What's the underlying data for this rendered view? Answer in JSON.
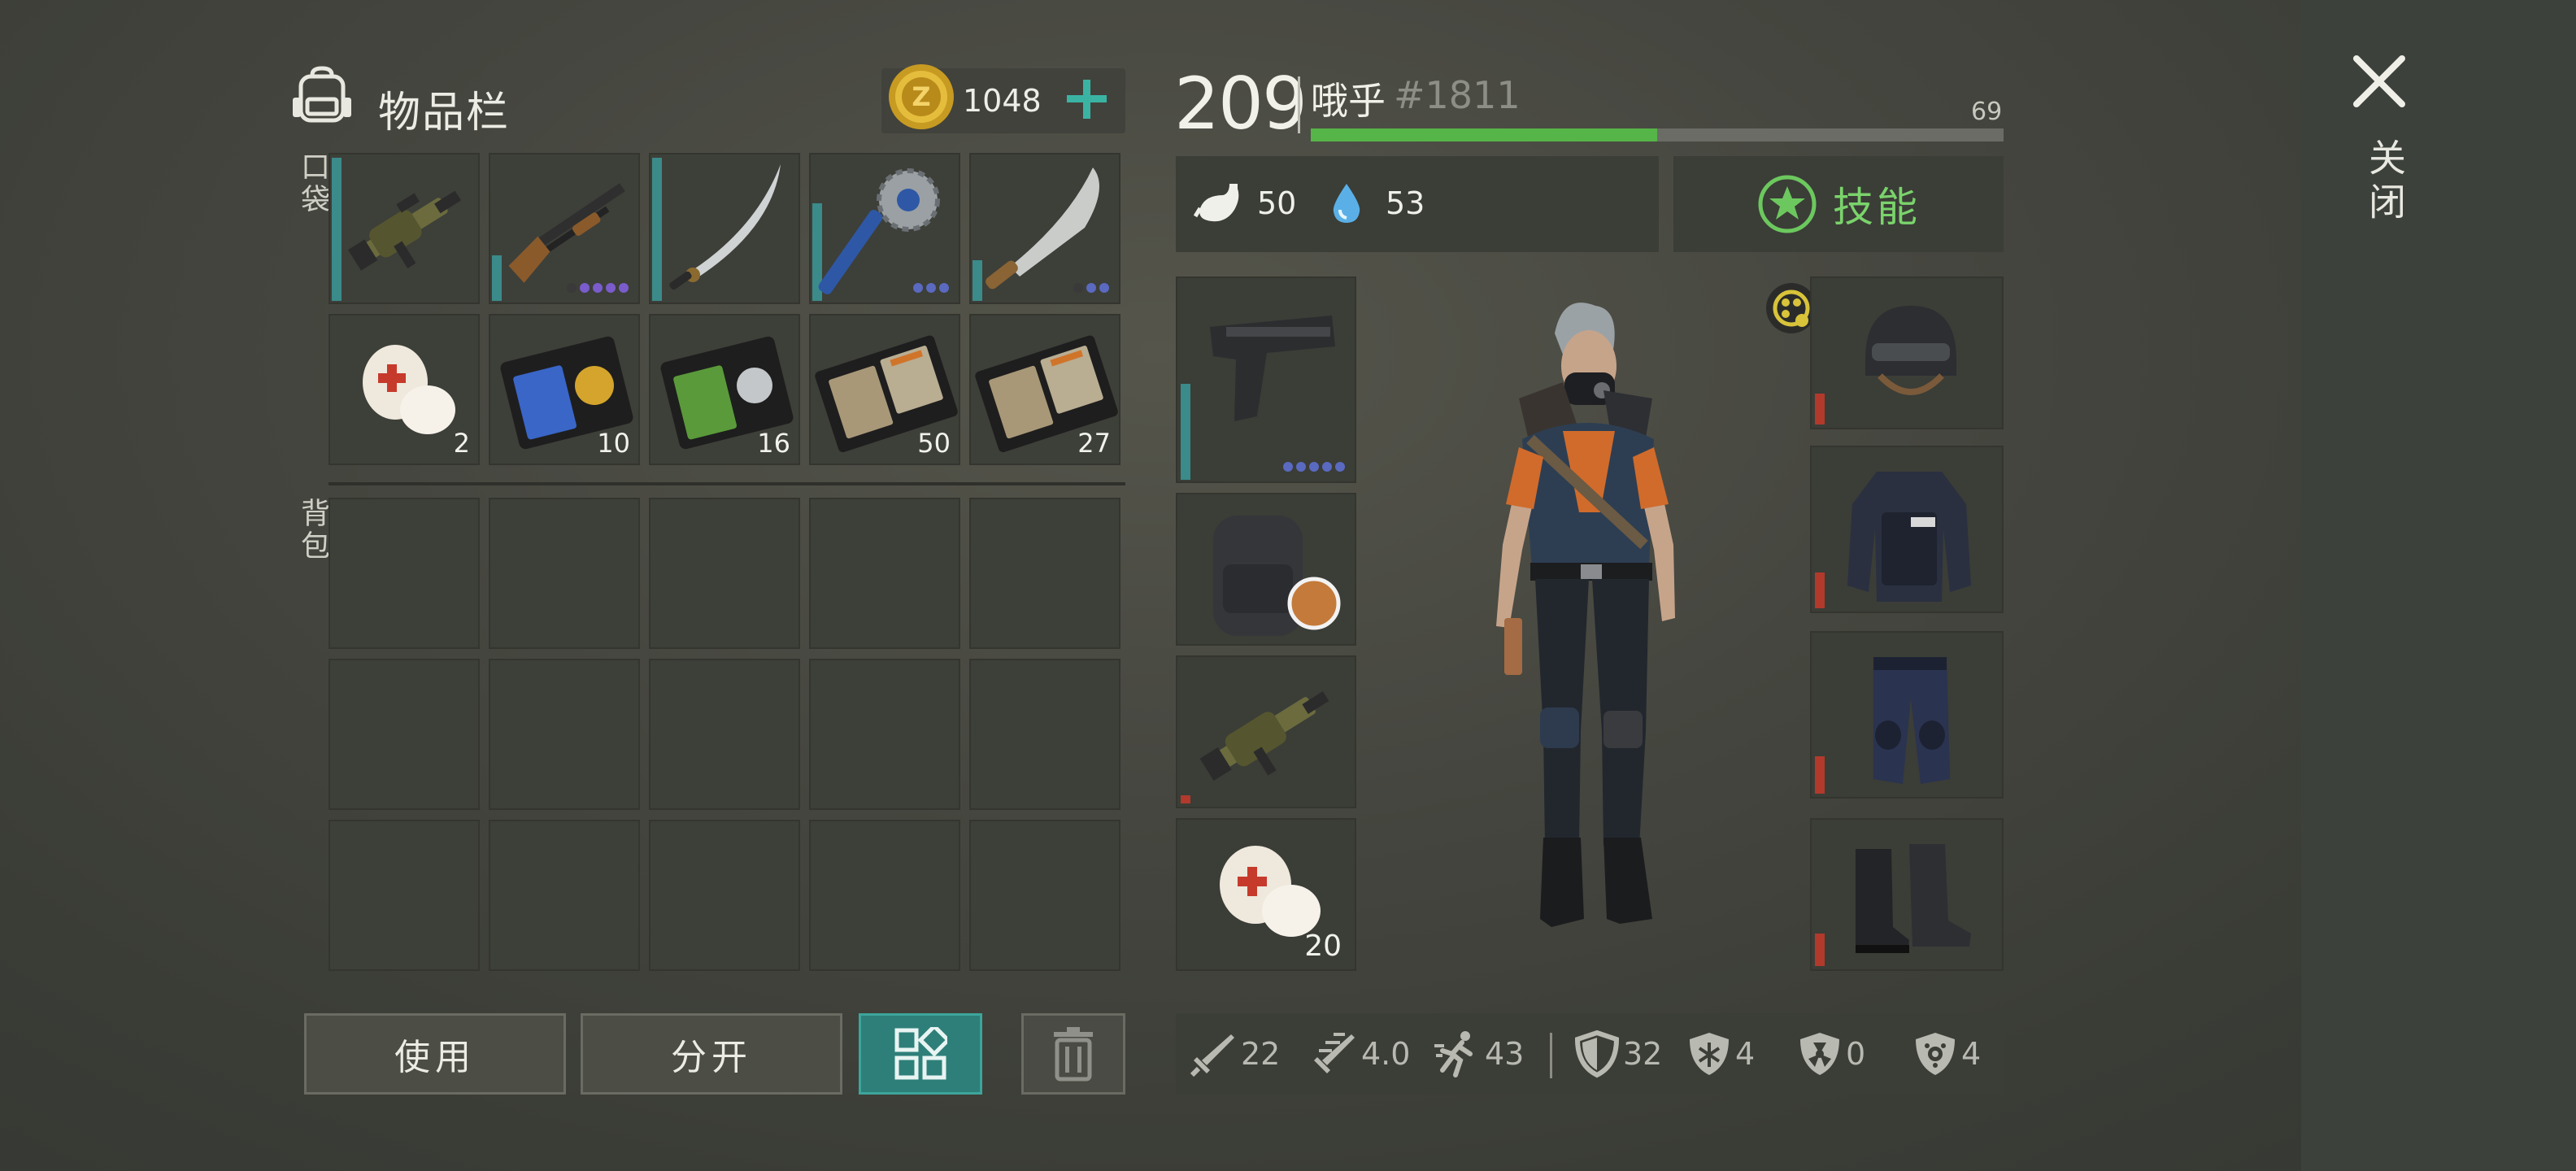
{
  "inventory": {
    "title": "物品栏",
    "coins": "1048",
    "pocket_label": "口袋",
    "backpack_label": "背包",
    "pocket_slots": [
      {
        "item": "grenade-launcher",
        "count": "",
        "durability": 1.0,
        "dots": []
      },
      {
        "item": "shotgun",
        "count": "",
        "durability": 0.3,
        "dots": [
          "#3a3a3a",
          "#7a5ccc",
          "#7a5ccc",
          "#7a5ccc",
          "#7a5ccc"
        ]
      },
      {
        "item": "katana",
        "count": "",
        "durability": 1.0,
        "dots": []
      },
      {
        "item": "saw-mace",
        "count": "",
        "durability": 0.65,
        "dots": [
          "#5a6ac0",
          "#5a6ac0",
          "#5a6ac0"
        ]
      },
      {
        "item": "machete",
        "count": "",
        "durability": 0.28,
        "dots": [
          "#3a3a3a",
          "#5a6ac0",
          "#5a6ac0"
        ]
      },
      {
        "item": "bandage",
        "count": "2",
        "durability": 0,
        "dots": []
      },
      {
        "item": "police-badge-gold",
        "count": "10",
        "durability": 0,
        "dots": []
      },
      {
        "item": "police-badge-silver",
        "count": "16",
        "durability": 0,
        "dots": []
      },
      {
        "item": "patrol-id",
        "count": "50",
        "durability": 0,
        "dots": []
      },
      {
        "item": "patrol-id",
        "count": "27",
        "durability": 0,
        "dots": []
      }
    ],
    "backpack_slots": 15,
    "buttons": {
      "use": "使用",
      "split": "分开"
    }
  },
  "character": {
    "level": "209",
    "name": "哦乎",
    "tag": "#1811",
    "xp_value": "69",
    "xp_fraction": 0.5,
    "hunger": "50",
    "thirst": "53",
    "skills_label": "技能",
    "equipment_left": [
      {
        "item": "pistol",
        "count": ""
      },
      {
        "item": "backpack",
        "count": ""
      },
      {
        "item": "grenade-launcher",
        "count": ""
      },
      {
        "item": "bandage",
        "count": "20"
      }
    ],
    "equipment_right": [
      "helmet",
      "body-armor",
      "pants",
      "boots"
    ],
    "close_label": "关闭",
    "stats": {
      "damage": "22",
      "attack_speed": "4.0",
      "move_speed": "43",
      "armor": "32",
      "cold_resist": "4",
      "radiation_resist": "0",
      "toxic_resist": "4"
    }
  },
  "colors": {
    "accent_teal": "#3b8b8a",
    "xp_green": "#56b548",
    "skill_green": "#7ad36b",
    "durability_red": "#b13a2c"
  }
}
